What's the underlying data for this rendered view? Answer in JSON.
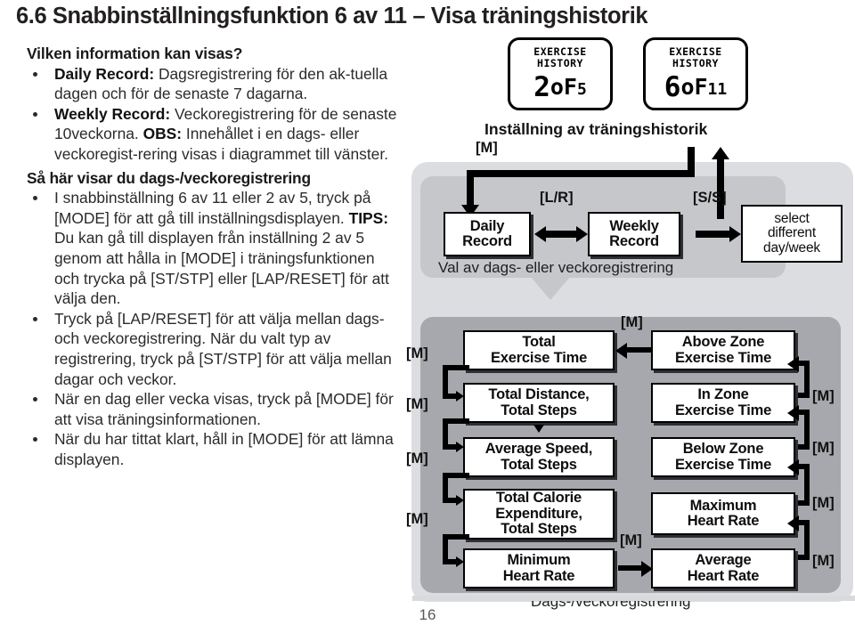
{
  "document": {
    "title": "6.6 Snabbinställningsfunktion 6 av 11 – Visa träningshistorik",
    "page_number": "16"
  },
  "left_column": {
    "heading1": "Vilken information kan visas?",
    "bullets1": [
      {
        "lead": "Daily Record:",
        "text": " Dagsregistrering för den ak-tuella dagen och för de senaste 7 dagarna."
      },
      {
        "lead": "Weekly Record:",
        "text": " Veckoregistrering för de senaste 10veckorna.",
        "note_lead": "OBS:",
        "note_text": " Innehållet i en dags- eller veckoregist-rering visas i diagrammet till vänster."
      }
    ],
    "heading2": "Så här visar du dags-/veckoregistrering",
    "bullets2": [
      {
        "text": "I snabbinställning 6 av 11 eller 2 av 5, tryck på [MODE] för att gå till inställningsdisplayen.",
        "note_lead": "TIPS:",
        "note_text": " Du kan gå till displayen från inställning 2 av 5 genom att hålla in [MODE] i träningsfunktionen och trycka på [ST/STP] eller [LAP/RESET] för att välja den."
      },
      {
        "text": "Tryck på [LAP/RESET] för att välja mellan dags- och veckoregistrering. När du valt typ av registrering, tryck på [ST/STP] för att välja mellan dagar och veckor."
      },
      {
        "text": "När en dag eller vecka visas, tryck på [MODE] för att visa träningsinformationen."
      },
      {
        "text": "När du har tittat klart, håll in [MODE] för att lämna displayen."
      }
    ]
  },
  "diagram": {
    "lcd_left": {
      "title_line1": "EXERCISE",
      "title_line2": "HISTORY",
      "value_big": "2",
      "value_mid": "oF",
      "value_small": "5"
    },
    "lcd_right": {
      "title_line1": "EXERCISE",
      "title_line2": "HISTORY",
      "value_big": "6",
      "value_mid": "oF",
      "value_small": "11"
    },
    "header_label": "Inställning av träningshistorik",
    "top_panel": {
      "caption": "Val av dags- eller veckoregistrering",
      "boxes": [
        {
          "id": "daily-record",
          "label": "Daily\nRecord"
        },
        {
          "id": "weekly-record",
          "label": "Weekly\nRecord"
        },
        {
          "id": "select-different",
          "label": "select\ndifferent\nday/week"
        }
      ],
      "tags": {
        "m_top": "[M]",
        "lr": "[L/R]",
        "ss": "[S/S]"
      }
    },
    "bottom_panel": {
      "caption": "Dags-/veckoregistrering",
      "left_boxes": [
        {
          "id": "total-exercise-time",
          "label": "Total\nExercise Time"
        },
        {
          "id": "total-distance-steps",
          "label": "Total Distance,\nTotal Steps"
        },
        {
          "id": "average-speed-steps",
          "label": "Average Speed,\nTotal Steps"
        },
        {
          "id": "total-calorie-steps",
          "label": "Total Calorie\nExpenditure,\nTotal Steps"
        },
        {
          "id": "minimum-heart-rate",
          "label": "Minimum\nHeart Rate"
        }
      ],
      "right_boxes": [
        {
          "id": "above-zone-exercise-time",
          "label": "Above Zone\nExercise Time"
        },
        {
          "id": "in-zone-exercise-time",
          "label": "In Zone\nExercise Time"
        },
        {
          "id": "below-zone-exercise-time",
          "label": "Below Zone\nExercise Time"
        },
        {
          "id": "maximum-heart-rate",
          "label": "Maximum\nHeart Rate"
        },
        {
          "id": "average-heart-rate",
          "label": "Average\nHeart Rate"
        }
      ],
      "mode_tag": "[M]",
      "left_tags": [
        "[M]",
        "[M]",
        "[M]",
        "[M]"
      ],
      "right_tags": [
        "[M]",
        "[M]",
        "[M]",
        "[M]"
      ],
      "center_top_tag": "[M]",
      "center_bottom_tag": "[M]"
    }
  }
}
